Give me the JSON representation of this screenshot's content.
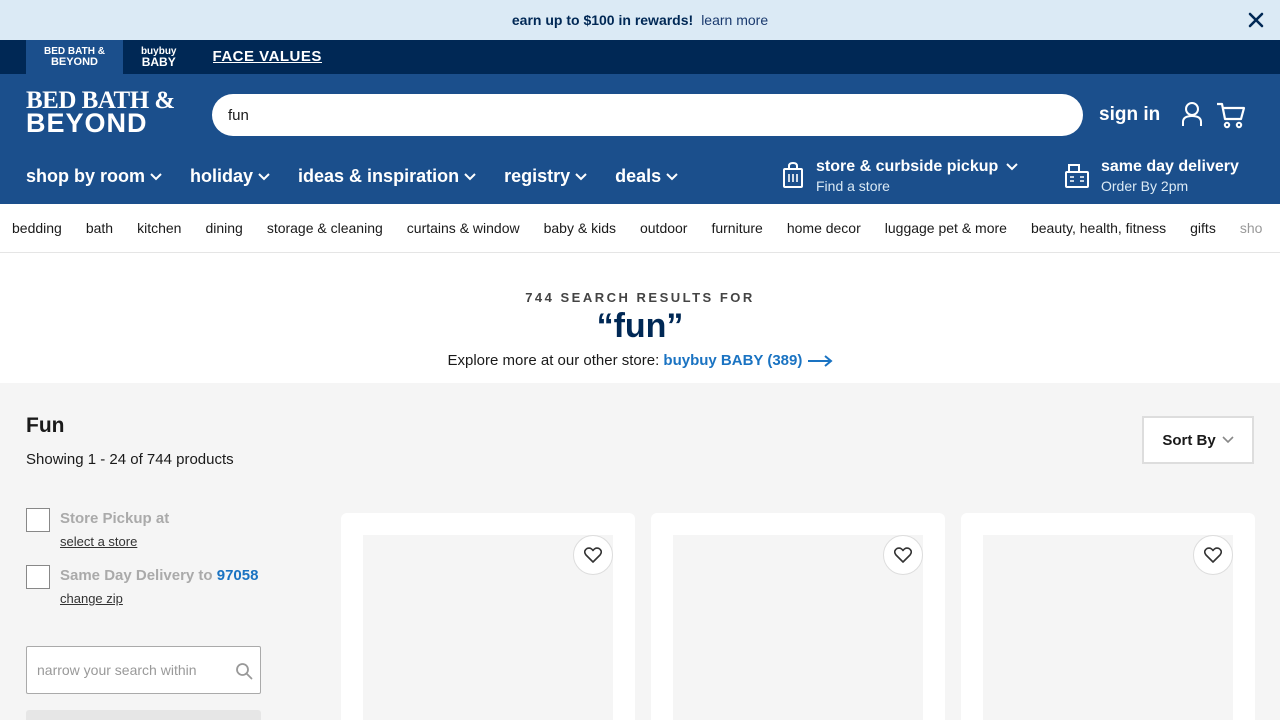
{
  "promo": {
    "bold_text": "earn up to $100 in rewards!",
    "link_text": "learn more"
  },
  "brands": {
    "bbb_line1": "BED BATH &",
    "bbb_line2": "BEYOND",
    "baby_line1": "buybuy",
    "baby_line2": "BABY",
    "facevalues": "FACE VALUES"
  },
  "header": {
    "logo_line1": "BED BATH &",
    "logo_line2": "BEYOND",
    "search_value": "fun",
    "signin": "sign in"
  },
  "nav": {
    "items": [
      {
        "label": "shop by room"
      },
      {
        "label": "holiday"
      },
      {
        "label": "ideas & inspiration"
      },
      {
        "label": "registry"
      },
      {
        "label": "deals"
      }
    ],
    "pickup_title": "store & curbside pickup",
    "pickup_sub": "Find a store",
    "delivery_title": "same day delivery",
    "delivery_sub": "Order By 2pm"
  },
  "categories": [
    "bedding",
    "bath",
    "kitchen",
    "dining",
    "storage & cleaning",
    "curtains & window",
    "baby & kids",
    "outdoor",
    "furniture",
    "home decor",
    "luggage pet & more",
    "beauty, health, fitness",
    "gifts",
    "sho"
  ],
  "results": {
    "count_label": "744 SEARCH RESULTS FOR",
    "term": "“fun”",
    "explore_text": "Explore more at our other store:",
    "explore_link": "buybuy BABY (389)"
  },
  "listing": {
    "title": "Fun",
    "showing": "Showing 1 - 24 of 744 products",
    "sort_label": "Sort By"
  },
  "filters": {
    "pickup_label": "Store Pickup at",
    "pickup_link": "select a store",
    "delivery_label": "Same Day Delivery to",
    "delivery_zip": "97058",
    "delivery_link": "change zip",
    "narrow_placeholder": "narrow your search within"
  },
  "colors": {
    "brand_navy": "#002855",
    "brand_blue": "#1b4f8c",
    "link_blue": "#1a73c2",
    "promo_bg": "#dbeaf5"
  }
}
